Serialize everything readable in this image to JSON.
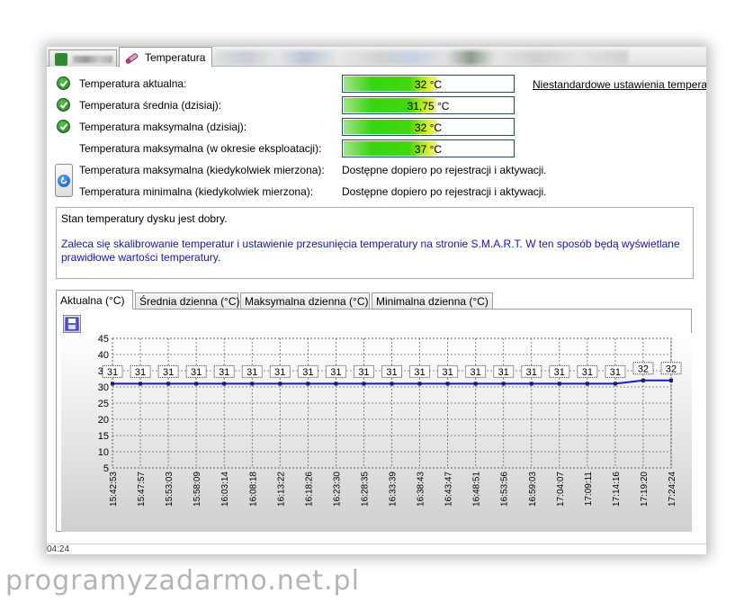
{
  "tabs": {
    "active_label": "Temperatura"
  },
  "rows": [
    {
      "label": "Temperatura aktualna:",
      "status": "ok",
      "value": "32 °C",
      "level": 0.56
    },
    {
      "label": "Temperatura średnia (dzisiaj):",
      "status": "ok",
      "value": "31,75 °C",
      "level": 0.55
    },
    {
      "label": "Temperatura maksymalna (dzisiaj):",
      "status": "ok",
      "value": "32 °C",
      "level": 0.56
    },
    {
      "label": "Temperatura maksymalna (w okresie eksploatacji):",
      "status": "none",
      "value": "37 °C",
      "level": 0.56
    },
    {
      "label": "Temperatura maksymalna (kiedykolwiek mierzona):",
      "text": "Dostępne dopiero po rejestracji i aktywacji."
    },
    {
      "label": "Temperatura minimalna (kiedykolwiek mierzona):",
      "text": "Dostępne dopiero po rejestracji i aktywacji."
    }
  ],
  "custom_settings_link": "Niestandardowe ustawienia tempera",
  "message": {
    "status_line": "Stan temperatury dysku jest dobry.",
    "recommendation": "Zaleca się skalibrowanie temperatur i ustawienie przesunięcia temperatury na stronie S.M.A.R.T. W ten sposób będą wyświetlane prawidłowe wartości temperatury."
  },
  "chart_tabs": [
    "Aktualna (°C)",
    "Średnia dzienna (°C)",
    "Maksymalna dzienna (°C)",
    "Minimalna dzienna (°C)"
  ],
  "bottom_status": "04:24",
  "watermark": "programyzadarmo.net.pl",
  "colors": {
    "ok_green": "#1f7a1f",
    "bar_green": "#35d60f",
    "message_blue": "#1414b8",
    "series_blue": "#1a1acc"
  },
  "chart_data": {
    "type": "line",
    "x": [
      "15:42:53",
      "15:47:57",
      "15:53:03",
      "15:58:09",
      "16:03:14",
      "16:08:18",
      "16:13:22",
      "16:18:26",
      "16:23:30",
      "16:28:35",
      "16:33:39",
      "16:38:43",
      "16:43:47",
      "16:48:51",
      "16:53:56",
      "16:59:03",
      "17:04:07",
      "17:09:11",
      "17:14:16",
      "17:19:20",
      "17:24:24"
    ],
    "series": [
      {
        "values": [
          31,
          31,
          31,
          31,
          31,
          31,
          31,
          31,
          31,
          31,
          31,
          31,
          31,
          31,
          31,
          31,
          31,
          31,
          31,
          32,
          32
        ]
      }
    ],
    "data_labels": [
      "31",
      "31",
      "31",
      "31",
      "31",
      "31",
      "31",
      "31",
      "31",
      "31",
      "31",
      "31",
      "31",
      "31",
      "31",
      "31",
      "31",
      "31",
      "31",
      "32",
      "32"
    ],
    "ylim": [
      5,
      45
    ],
    "yticks": [
      5,
      10,
      15,
      20,
      25,
      30,
      35,
      40,
      45
    ],
    "grid": true
  }
}
